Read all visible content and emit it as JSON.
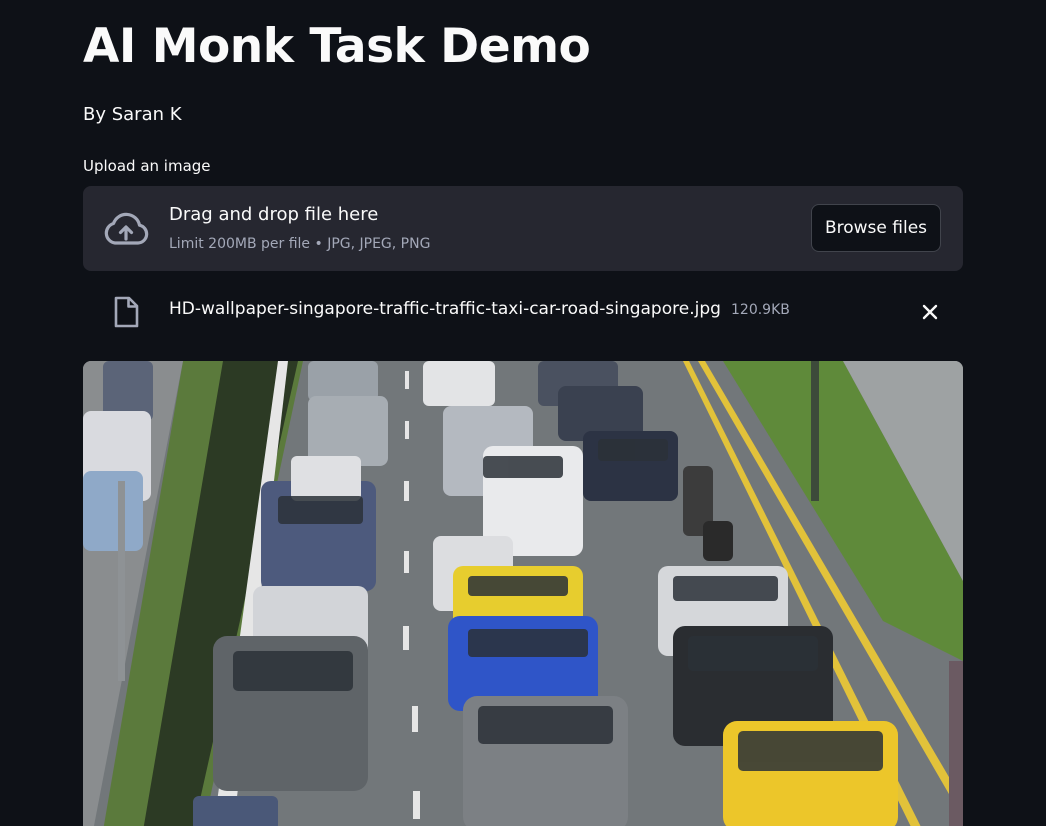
{
  "app": {
    "title": "AI Monk Task Demo",
    "byline": "By Saran K"
  },
  "uploader": {
    "label": "Upload an image",
    "drop_title": "Drag and drop file here",
    "drop_subtitle": "Limit 200MB per file • JPG, JPEG, PNG",
    "browse_label": "Browse files",
    "icon": "cloud-upload-icon"
  },
  "uploaded_file": {
    "name": "HD-wallpaper-singapore-traffic-traffic-taxi-car-road-singapore.jpg",
    "size": "120.9KB",
    "icon": "file-icon",
    "remove_icon": "close-icon"
  },
  "colors": {
    "background": "#0e1117",
    "dropzone": "#262730",
    "text": "#fafafa",
    "muted_text": "#a3a8b8"
  }
}
